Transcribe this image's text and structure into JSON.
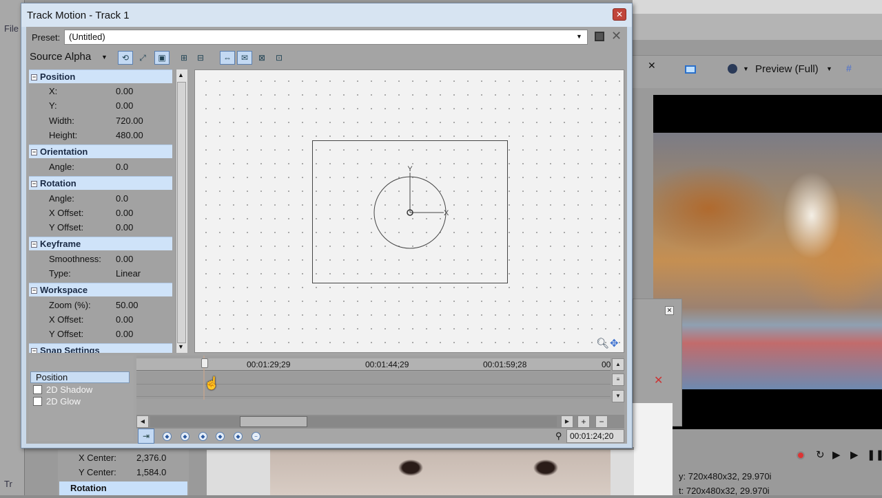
{
  "background_app": {
    "menu_file": "File",
    "track_label": "Tr",
    "preview_label": "Preview (Full)",
    "status_line1": "720x480x32, 29.970i",
    "status_line2": "720x480x32, 29.970i",
    "props": [
      {
        "name": "X Center:",
        "value": "2,376.0"
      },
      {
        "name": "Y Center:",
        "value": "1,584.0"
      }
    ],
    "rotation_header": "Rotation"
  },
  "dialog": {
    "title": "Track Motion - Track 1",
    "close_label": "✕",
    "preset_label": "Preset:",
    "preset_value": "(Untitled)",
    "source_alpha": "Source Alpha"
  },
  "property_grid": {
    "categories": [
      {
        "label": "Position",
        "props": [
          {
            "name": "X:",
            "value": "0.00"
          },
          {
            "name": "Y:",
            "value": "0.00"
          },
          {
            "name": "Width:",
            "value": "720.00"
          },
          {
            "name": "Height:",
            "value": "480.00"
          }
        ]
      },
      {
        "label": "Orientation",
        "props": [
          {
            "name": "Angle:",
            "value": "0.0"
          }
        ]
      },
      {
        "label": "Rotation",
        "props": [
          {
            "name": "Angle:",
            "value": "0.0"
          },
          {
            "name": "X Offset:",
            "value": "0.00"
          },
          {
            "name": "Y Offset:",
            "value": "0.00"
          }
        ]
      },
      {
        "label": "Keyframe",
        "props": [
          {
            "name": "Smoothness:",
            "value": "0.00"
          },
          {
            "name": "Type:",
            "value": "Linear"
          }
        ]
      },
      {
        "label": "Workspace",
        "props": [
          {
            "name": "Zoom (%):",
            "value": "50.00"
          },
          {
            "name": "X Offset:",
            "value": "0.00"
          },
          {
            "name": "Y Offset:",
            "value": "0.00"
          }
        ]
      },
      {
        "label": "Snap Settings",
        "props": []
      }
    ]
  },
  "workspace": {
    "axis_x": "X",
    "axis_y": "Y"
  },
  "timeline": {
    "tracks": [
      {
        "label": "Position",
        "selected": true
      },
      {
        "label": "2D Shadow",
        "checked": false
      },
      {
        "label": "2D Glow",
        "checked": false
      }
    ],
    "ruler_labels": [
      "00:01:29;29",
      "00:01:44;29",
      "00:01:59;28",
      "00"
    ],
    "timecode": "00:01:24;20"
  }
}
